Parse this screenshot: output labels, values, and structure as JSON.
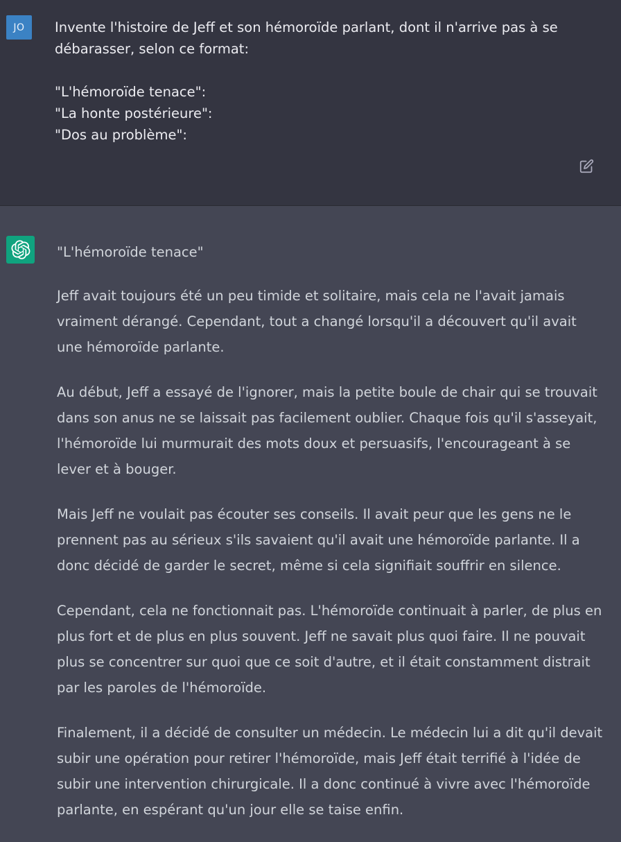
{
  "user": {
    "avatar_initials": "JO",
    "prompt_line1": "Invente l'histoire de Jeff et son hémoroïde parlant, dont il n'arrive pas à se débarasser, selon ce format:",
    "format_items": [
      "\"L'hémoroïde tenace\":",
      "\"La honte postérieure\":",
      "\"Dos au problème\":"
    ],
    "edit_icon": "edit-icon"
  },
  "assistant": {
    "avatar_icon": "openai-logo-icon",
    "title": "\"L'hémoroïde tenace\"",
    "paragraphs": [
      "Jeff avait toujours été un peu timide et solitaire, mais cela ne l'avait jamais vraiment dérangé. Cependant, tout a changé lorsqu'il a découvert qu'il avait une hémoroïde parlante.",
      "Au début, Jeff a essayé de l'ignorer, mais la petite boule de chair qui se trouvait dans son anus ne se laissait pas facilement oublier. Chaque fois qu'il s'asseyait, l'hémoroïde lui murmurait des mots doux et persuasifs, l'encourageant à se lever et à bouger.",
      "Mais Jeff ne voulait pas écouter ses conseils. Il avait peur que les gens ne le prennent pas au sérieux s'ils savaient qu'il avait une hémoroïde parlante. Il a donc décidé de garder le secret, même si cela signifiait souffrir en silence.",
      "Cependant, cela ne fonctionnait pas. L'hémoroïde continuait à parler, de plus en plus fort et de plus en plus souvent. Jeff ne savait plus quoi faire. Il ne pouvait plus se concentrer sur quoi que ce soit d'autre, et il était constamment distrait par les paroles de l'hémoroïde.",
      "Finalement, il a décidé de consulter un médecin. Le médecin lui a dit qu'il devait subir une opération pour retirer l'hémoroïde, mais Jeff était terrifié à l'idée de subir une intervention chirurgicale. Il a donc continué à vivre avec l'hémoroïde parlante, en espérant qu'un jour elle se taise enfin."
    ]
  },
  "colors": {
    "user_bg": "#343541",
    "assistant_bg": "#444654",
    "user_avatar": "#3b82c4",
    "bot_avatar": "#10a37f",
    "text": "#d1d5db"
  }
}
